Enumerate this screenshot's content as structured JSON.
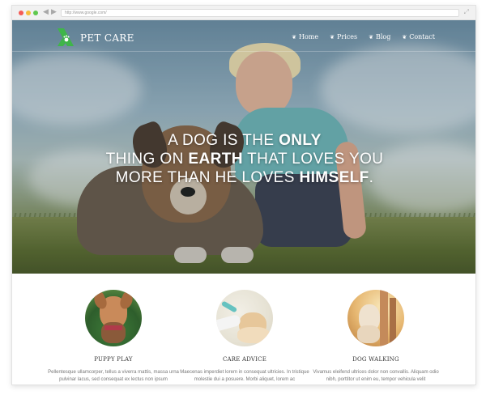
{
  "browser": {
    "url": "http://www.google.com/"
  },
  "site": {
    "brand": "PET CARE",
    "nav": [
      {
        "label": "Home"
      },
      {
        "label": "Prices"
      },
      {
        "label": "Blog"
      },
      {
        "label": "Contact"
      }
    ]
  },
  "hero": {
    "quote_line1_pre": "A DOG IS THE ",
    "quote_line1_bold": "ONLY",
    "quote_line2_pre": "THING ON ",
    "quote_line2_bold": "EARTH",
    "quote_line2_post": " THAT LOVES YOU",
    "quote_line3_pre": "MORE THAN HE LOVES ",
    "quote_line3_bold": "HIMSELF",
    "quote_line3_post": "."
  },
  "features": [
    {
      "title": "PUPPY PLAY",
      "text": "Pellentesque ullamcorper, tellus a viverra mattis, massa urna pulvinar lacus, sed consequat ex lectus non ipsum"
    },
    {
      "title": "CARE ADVICE",
      "text": "Maecenas imperdiet lorem in consequat ultricies. In tristique molestie dui a posuere. Morbi aliquet, lorem ac"
    },
    {
      "title": "DOG WALKING",
      "text": "Vivamus eleifend ultrices dolor non convallis. Aliquam odio nibh, porttitor ut enim eu, tempor vehicula velit"
    }
  ],
  "colors": {
    "brand_green": "#3fb54a",
    "hero_text": "#ffffff"
  },
  "icons": {
    "logo": "paw-logo-icon",
    "nav_bullet": "paw-icon"
  }
}
